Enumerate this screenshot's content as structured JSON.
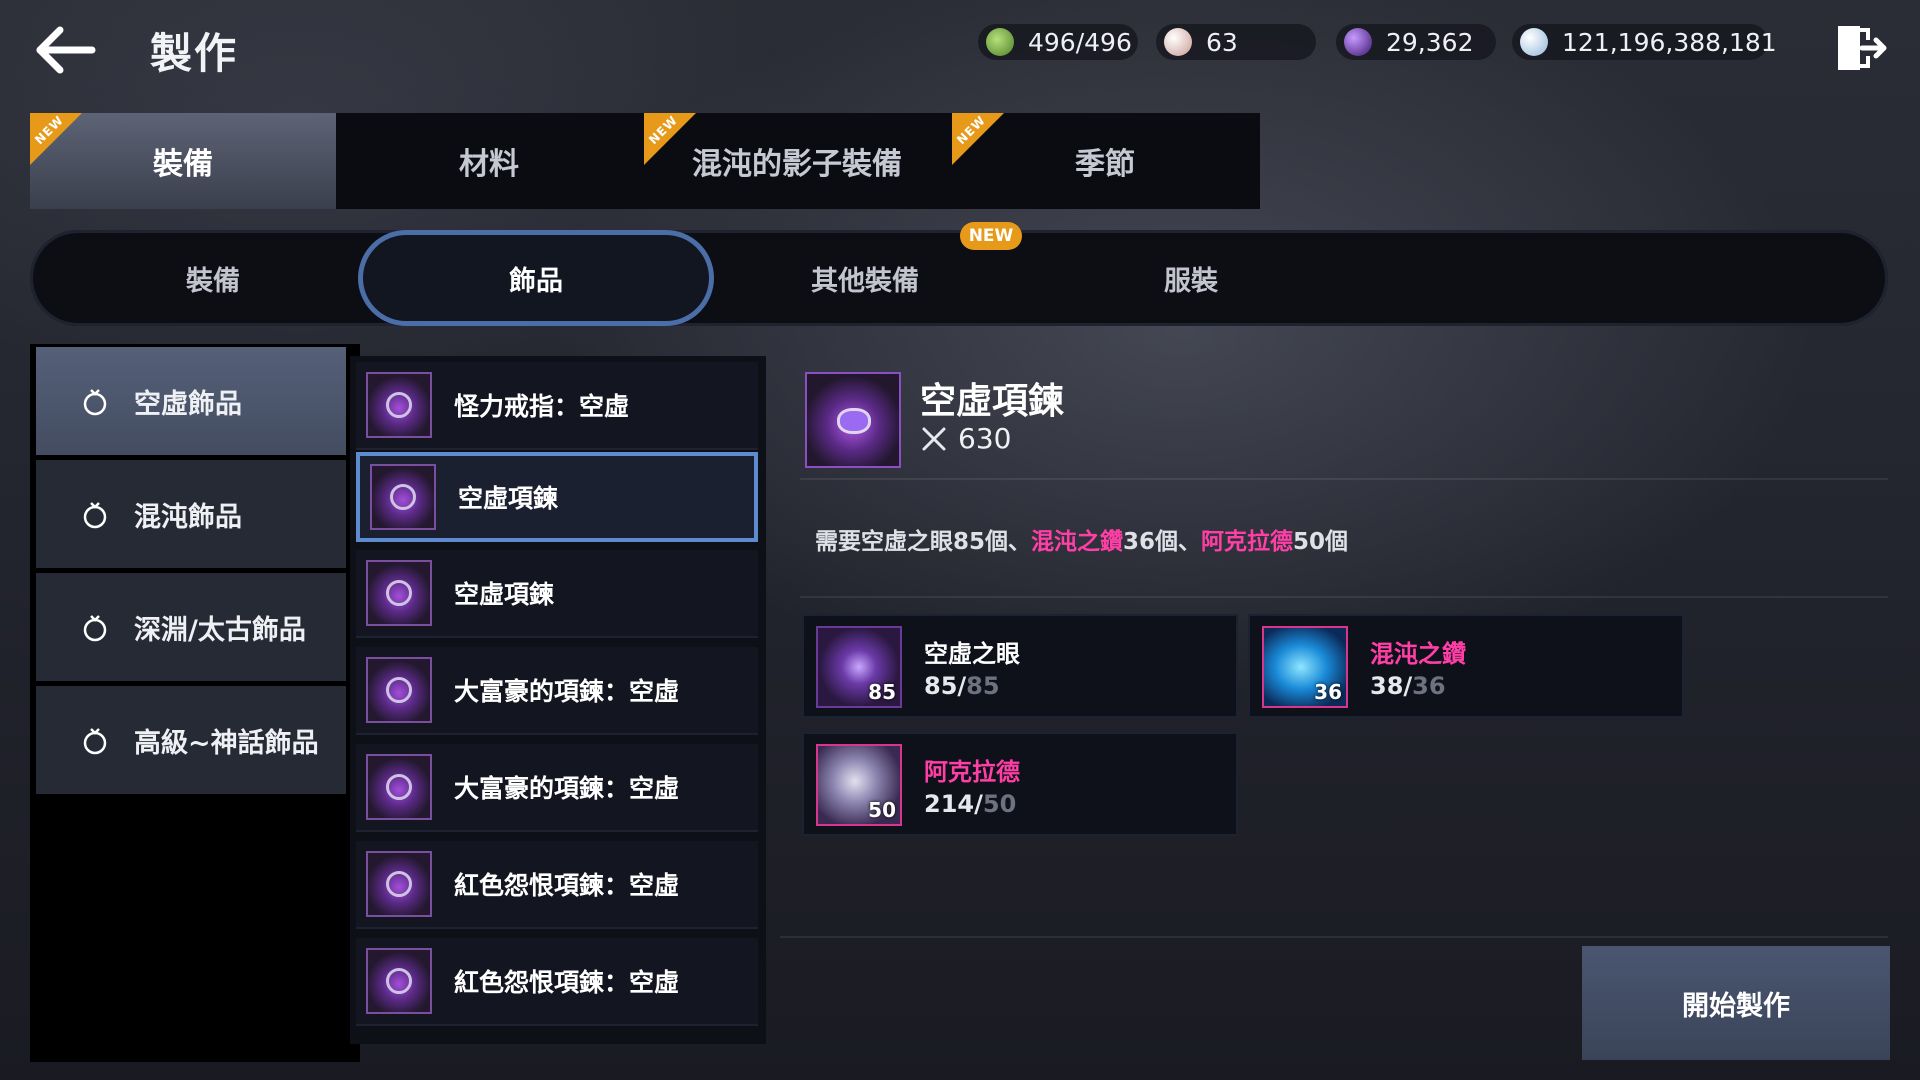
{
  "header": {
    "title": "製作",
    "currencies": [
      {
        "icon": "stamina-icon",
        "value": "496/496",
        "color": "#7db34a"
      },
      {
        "icon": "pearl-icon",
        "value": "63",
        "color": "#d9b4ad"
      },
      {
        "icon": "dark-orb-icon",
        "value": "29,362",
        "color": "#7a3bd6"
      },
      {
        "icon": "silver-coin-icon",
        "value": "121,196,388,181",
        "color": "#b9d4ea"
      }
    ]
  },
  "top_tabs": [
    {
      "label": "裝備",
      "new": true,
      "active": true
    },
    {
      "label": "材料",
      "new": false,
      "active": false
    },
    {
      "label": "混沌的影子裝備",
      "new": true,
      "active": false
    },
    {
      "label": "季節",
      "new": true,
      "active": false
    }
  ],
  "new_badge": "NEW",
  "sub_tabs": [
    {
      "label": "裝備"
    },
    {
      "label": "飾品"
    },
    {
      "label": "其他裝備"
    },
    {
      "label": "服裝"
    }
  ],
  "sub_new_badge": "NEW",
  "categories": [
    {
      "label": "空虛飾品"
    },
    {
      "label": "混沌飾品"
    },
    {
      "label": "深淵/太古飾品"
    },
    {
      "label": "高級~神話飾品"
    }
  ],
  "items": [
    {
      "name": "怪力戒指：空虛"
    },
    {
      "name": "空虛項鍊"
    },
    {
      "name": "空虛項鍊"
    },
    {
      "name": "大富豪的項鍊：空虛"
    },
    {
      "name": "大富豪的項鍊：空虛"
    },
    {
      "name": "紅色怨恨項鍊：空虛"
    },
    {
      "name": "紅色怨恨項鍊：空虛"
    }
  ],
  "detail": {
    "name": "空虛項鍊",
    "power": "630",
    "req_prefix": "需要",
    "req_parts": [
      {
        "text": "空虛之眼",
        "highlight": false
      },
      {
        "text": "85個、",
        "highlight": false
      },
      {
        "text": "混沌之鑽",
        "highlight": true
      },
      {
        "text": "36個、",
        "highlight": false
      },
      {
        "text": "阿克拉德",
        "highlight": true
      },
      {
        "text": "50個",
        "highlight": false
      }
    ],
    "materials": [
      {
        "name": "空虛之眼",
        "owned": "85",
        "required": "85",
        "qty_badge": "85",
        "name_color": "#ffffff"
      },
      {
        "name": "混沌之鑽",
        "owned": "38",
        "required": "36",
        "qty_badge": "36",
        "name_color": "#ff3fa6"
      },
      {
        "name": "阿克拉德",
        "owned": "214",
        "required": "50",
        "qty_badge": "50",
        "name_color": "#ff3fa6"
      }
    ]
  },
  "start_button": "開始製作",
  "colors": {
    "accent_blue": "#4b6ea8",
    "new_orange": "#e79a1a",
    "highlight_pink": "#ff3fa6"
  }
}
